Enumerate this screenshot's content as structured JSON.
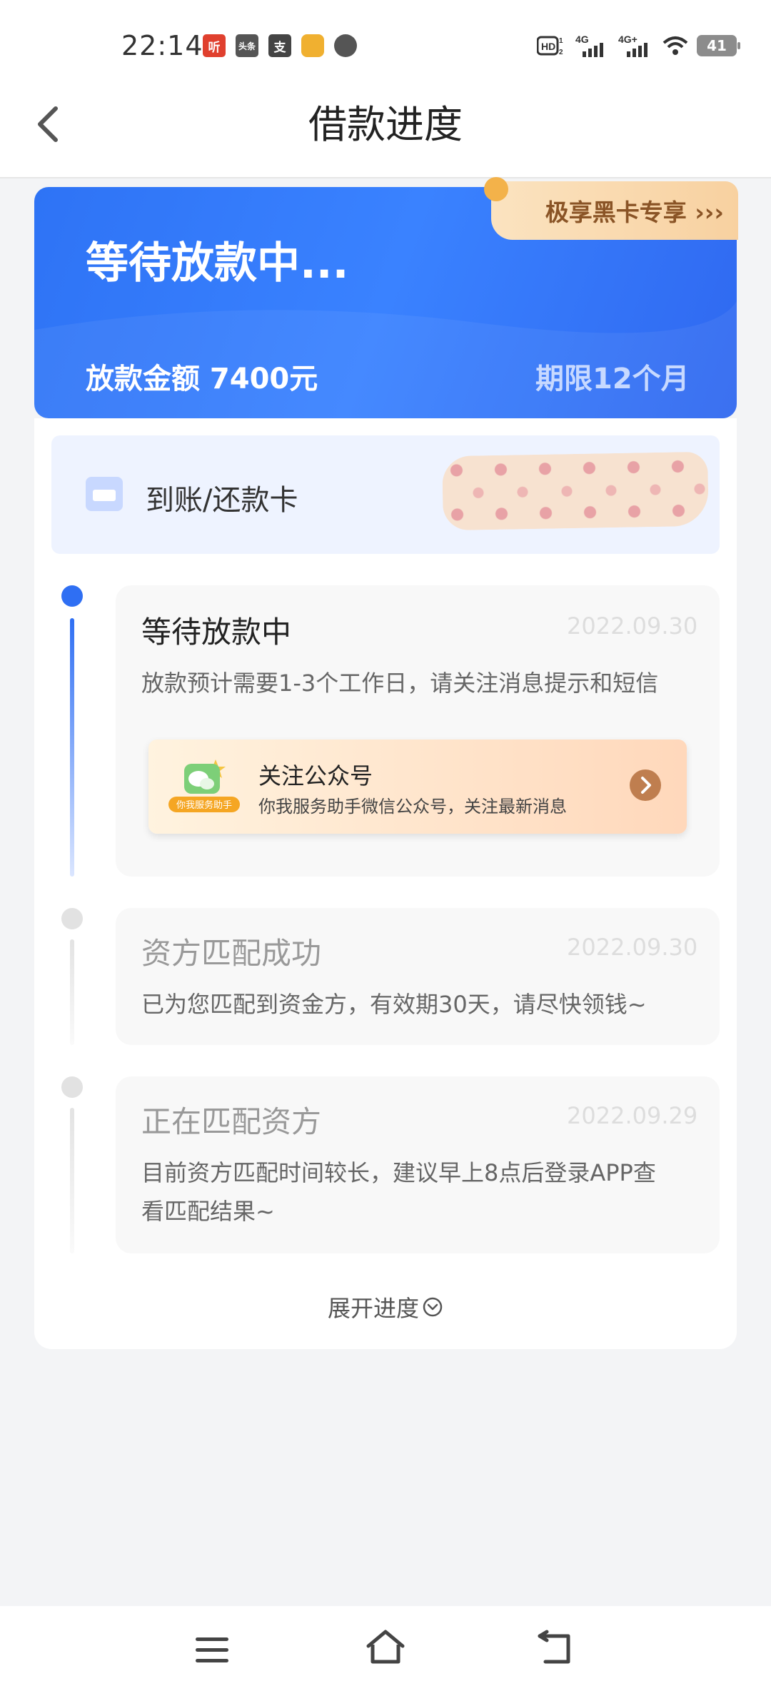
{
  "status_bar": {
    "time": "22:14",
    "battery": "41",
    "net1": "4G",
    "net2": "4G+",
    "apps": [
      {
        "icon": "ting-app-icon",
        "text": "听",
        "color": "#e0402e"
      },
      {
        "icon": "toutiao-app-icon",
        "text": "头条",
        "color": "#555555"
      },
      {
        "icon": "alipay-app-icon",
        "text": "支",
        "color": "#444444"
      },
      {
        "icon": "game-app-icon",
        "text": "",
        "color": "#f0b030"
      },
      {
        "icon": "compass-app-icon",
        "text": "",
        "color": "#555555"
      }
    ]
  },
  "header": {
    "title": "借款进度"
  },
  "hero": {
    "status": "等待放款中...",
    "amount": "放款金额 7400元",
    "term": "期限12个月",
    "badge": "极享黑卡专享 ›››"
  },
  "bank": {
    "label": "到账/还款卡"
  },
  "timeline": [
    {
      "title": "等待放款中",
      "date": "2022.09.30",
      "desc": "放款预计需要1-3个工作日，请关注消息提示和短信",
      "active": true
    },
    {
      "title": "资方匹配成功",
      "date": "2022.09.30",
      "desc": "已为您匹配到资金方，有效期30天，请尽快领钱~",
      "active": false
    },
    {
      "title": "正在匹配资方",
      "date": "2022.09.29",
      "desc_line1": "目前资方匹配时间较长，建议早上8点后登录APP查",
      "desc_line2": "看匹配结果~",
      "active": false
    }
  ],
  "wechat": {
    "title": "关注公众号",
    "subtitle": "你我服务助手微信公众号，关注最新消息",
    "logo_label": "你我服务助手"
  },
  "expand": {
    "label": "展开进度"
  },
  "colors": {
    "primary": "#2f6ff3",
    "accent": "#bf7e4f"
  }
}
